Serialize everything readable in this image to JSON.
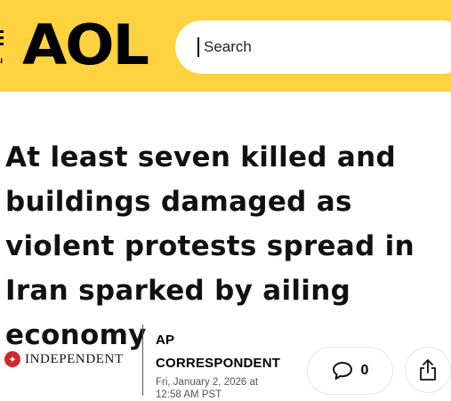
{
  "header": {
    "menu_label": "u",
    "logo_text": "AOL",
    "search": {
      "value": "",
      "placeholder": "Search"
    }
  },
  "article": {
    "headline": "At least seven killed and buildings damaged as violent protests spread in Iran sparked by ailing economy",
    "source": "INDEPENDENT",
    "author_line1": "AP",
    "author_line2": "CORRESPONDENT",
    "date_line1": "Fri, January 2, 2026 at",
    "date_line2": "12:58 AM PST",
    "comment_count": "0"
  },
  "colors": {
    "header_bg": "#ffd23f",
    "source_red": "#d0282e"
  },
  "icons": [
    "menu-icon",
    "search-caret",
    "eagle-icon",
    "comment-icon",
    "share-icon"
  ]
}
